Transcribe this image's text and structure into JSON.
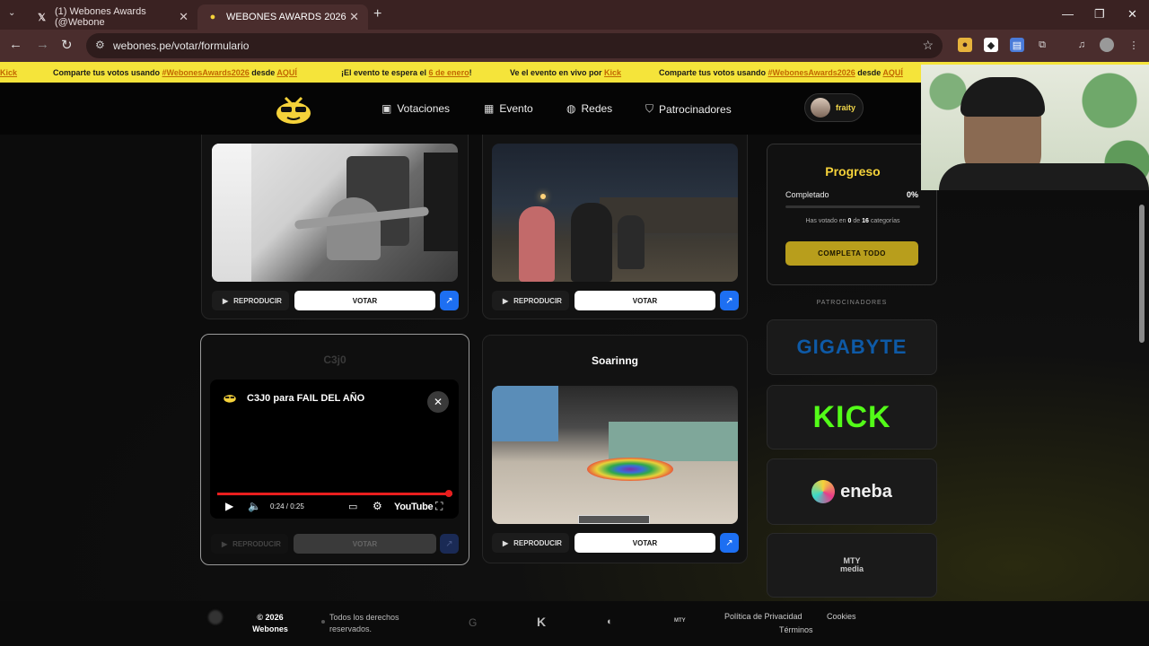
{
  "browser": {
    "tabs": [
      {
        "label": "(1) Webones Awards (@Webone",
        "icon": "x-logo"
      },
      {
        "label": "WEBONES AWARDS 2026",
        "icon": "webones-logo"
      }
    ],
    "url": "webones.pe/votar/formulario"
  },
  "ticker": {
    "items": [
      {
        "pre": "",
        "highlight": "Kick",
        "post": ""
      },
      {
        "pre": "Comparte tus votos usando ",
        "highlight": "#WebonesAwards2026",
        "mid": " desde ",
        "highlight2": "AQUÍ"
      },
      {
        "pre": "¡El evento te espera el ",
        "highlight": "6 de enero",
        "post": "!"
      },
      {
        "pre": "Ve el evento en vivo por ",
        "highlight": "Kick",
        "post": ""
      },
      {
        "pre": "Comparte tus votos usando ",
        "highlight": "#WebonesAwards2026",
        "mid": " desde ",
        "highlight2": "AQUÍ"
      }
    ]
  },
  "nav": {
    "items": [
      {
        "label": "Votaciones",
        "icon": "ballot-icon"
      },
      {
        "label": "Evento",
        "icon": "calendar-icon"
      },
      {
        "label": "Redes",
        "icon": "globe-icon"
      },
      {
        "label": "Patrocinadores",
        "icon": "shield-icon"
      }
    ],
    "user": "fraity"
  },
  "cards": {
    "reproducir": "REPRODUCIR",
    "votar": "VOTAR",
    "card3_title": "C3j0",
    "card4_title": "Soarinng"
  },
  "video_modal": {
    "title": "C3J0 para FAIL DEL AÑO",
    "time": "0:24 / 0:25",
    "platform": "YouTube",
    "progress_fraction": 0.98
  },
  "progress": {
    "title": "Progreso",
    "label": "Completado",
    "percent": "0%",
    "voted_pre": "Has votado en ",
    "voted_count": "0",
    "voted_mid": " de ",
    "voted_total": "16",
    "voted_post": " categorías",
    "button": "COMPLETA TODO"
  },
  "sponsors": {
    "heading": "PATROCINADORES",
    "items": [
      "GIGABYTE",
      "KICK",
      "eneba",
      "MTY media"
    ]
  },
  "footer": {
    "copyright": "© 2026",
    "brand": "Webones",
    "rights": "Todos los derechos reservados.",
    "links": [
      "Política de Privacidad",
      "Cookies",
      "Términos"
    ]
  },
  "colors": {
    "accent_yellow": "#f5e43a",
    "gold": "#d9b928",
    "link_blue": "#1d6ff2",
    "kick_green": "#53fc18",
    "gigabyte_blue": "#0e5aa7"
  }
}
